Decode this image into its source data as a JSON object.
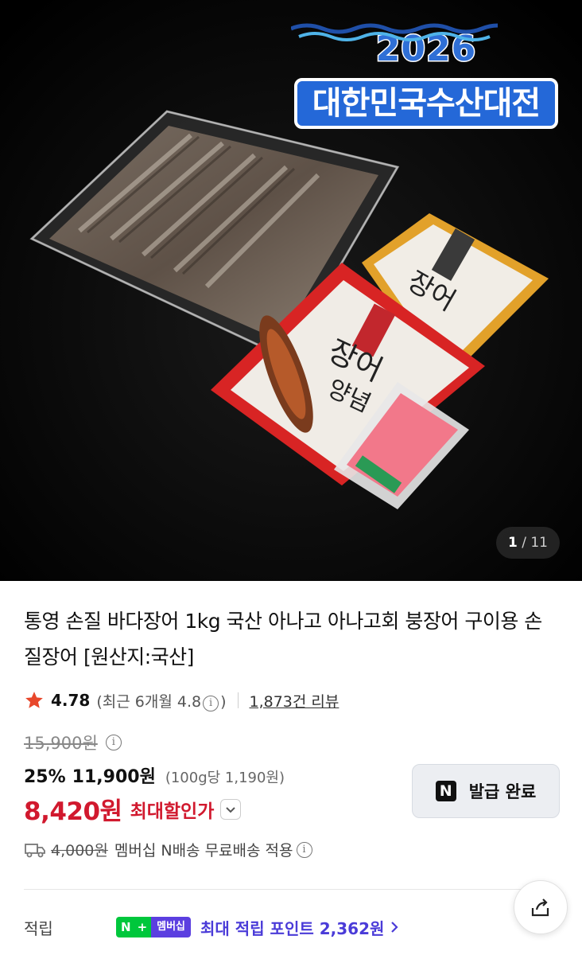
{
  "hero": {
    "badge_year": "2026",
    "badge_title": "대한민국수산대전",
    "counter_current": "1",
    "counter_total": "/ 11"
  },
  "product": {
    "title": "통영 손질 바다장어 1kg 국산 아나고 아나고회 붕장어 구이용 손질장어 [원산지:국산]",
    "rating": "4.78",
    "rating_recent": "(최근 6개월 4.8",
    "rating_recent_close": ")",
    "reviews": "1,873건 리뷰",
    "original_price": "15,900원",
    "discount_percent": "25%",
    "sale_price": "11,900원",
    "unit_price": "(100g당 1,190원)",
    "final_price": "8,420원",
    "final_label": "최대할인가"
  },
  "coupon": {
    "icon_letter": "N",
    "label": "발급 완료"
  },
  "shipping": {
    "original_fee": "4,000원",
    "text": "멤버십 N배송 무료배송 적용"
  },
  "points": {
    "label": "적립",
    "badge_n": "N",
    "badge_plus": "+",
    "badge_member": "멤버십",
    "text": "최대 적립 포인트 2,362원"
  },
  "colors": {
    "accent_red": "#d1192e",
    "points_purple": "#4a3bd8",
    "naver_green": "#00c73c",
    "badge_blue": "#2468d8"
  },
  "icons": [
    "star-icon",
    "info-icon",
    "chevron-down-icon",
    "n-logo-icon",
    "truck-icon",
    "chevron-right-icon",
    "share-icon"
  ]
}
